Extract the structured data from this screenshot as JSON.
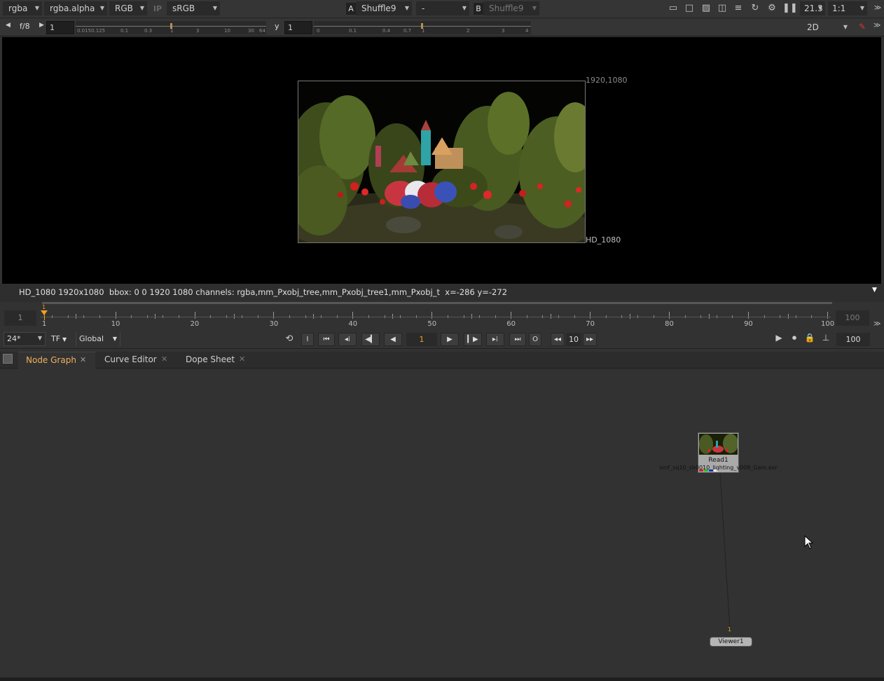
{
  "viewer_toolbar": {
    "channels": "rgba",
    "alpha_channel": "rgba.alpha",
    "display_channels": "RGB",
    "ip_label": "IP",
    "lut": "sRGB",
    "a_label": "A",
    "a_input": "Shuffle9",
    "compare_mode": "-",
    "b_label": "B",
    "b_input": "Shuffle9",
    "zoom": "21.3",
    "proxy_ratio": "1:1"
  },
  "exposure_bar": {
    "fstop": "f/8",
    "gain_value": "1",
    "gain_ticks": [
      "0.0150.125",
      "0.1",
      "0.3",
      "1",
      "3",
      "10",
      "30",
      "64"
    ],
    "gamma_label": "y",
    "gamma_value": "1",
    "gamma_ticks": [
      "0",
      "0.1",
      "0.4",
      "0.7",
      "1",
      "2",
      "3",
      "4"
    ],
    "view_mode": "2D"
  },
  "viewer": {
    "format_top_right": "1920,1080",
    "format_name": "HD_1080",
    "info_line": "HD_1080 1920x1080  bbox: 0 0 1920 1080 channels: rgba,mm_Pxobj_tree,mm_Pxobj_tree1,mm_Pxobj_t  x=-286 y=-272"
  },
  "timeline": {
    "start_frame": "1",
    "end_frame": "100",
    "current_frame": "1",
    "tick_labels": [
      "1",
      "10",
      "20",
      "30",
      "40",
      "50",
      "60",
      "70",
      "80",
      "90",
      "100"
    ],
    "fps": "24*",
    "time_format": "TF",
    "range_mode": "Global",
    "frame_display": "1",
    "in_button": "I",
    "out_button": "O",
    "skip_increment": "10",
    "last_frame_field": "100"
  },
  "tabs": [
    {
      "label": "Node Graph",
      "active": true
    },
    {
      "label": "Curve Editor",
      "active": false
    },
    {
      "label": "Dope Sheet",
      "active": false
    }
  ],
  "node_graph": {
    "read_node_name": "Read1",
    "read_node_file": "smf_sq10_sh0010_lighting_v008_Gam.exr",
    "viewer_node_name": "Viewer1",
    "viewer_input_index": "1"
  },
  "colors": {
    "accent": "#f0a020",
    "background": "#323232",
    "viewer_bg": "#000000",
    "active_tab_text": "#f0b060"
  }
}
